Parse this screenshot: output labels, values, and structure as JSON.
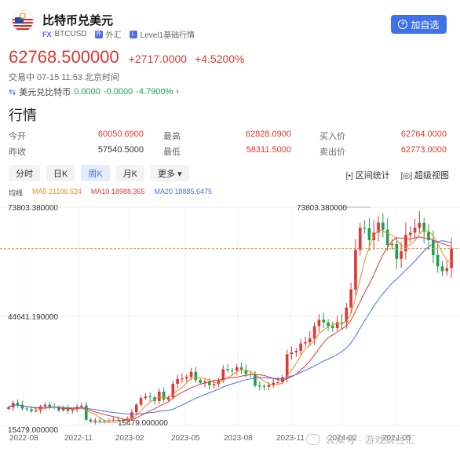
{
  "header": {
    "title": "比特币兑美元",
    "tag_fx": "FX",
    "symbol": "BTCUSD",
    "market": "外汇",
    "level": "Level1基础行情",
    "add_button": "加自选"
  },
  "price": {
    "last": "62768.500000",
    "change": "+2717.0000",
    "change_pct": "+4.5200%",
    "status": "交易中 07-15 11:53 北京时间"
  },
  "reverse": {
    "label": "美元兑比特币",
    "price": "0.0000",
    "change": "-0.0000",
    "pct": "-4.7900%"
  },
  "section_title": "行情",
  "quote": {
    "open_label": "今开",
    "open": "60050.6900",
    "high_label": "最高",
    "high": "62828.0900",
    "bid_label": "买入价",
    "bid": "62764.0000",
    "prev_label": "昨收",
    "prev": "57540.5000",
    "low_label": "最低",
    "low": "58311.5000",
    "ask_label": "卖出价",
    "ask": "62773.0000"
  },
  "tabs": [
    {
      "label": "分时",
      "active": false
    },
    {
      "label": "日K",
      "active": false
    },
    {
      "label": "周K",
      "active": true
    },
    {
      "label": "月K",
      "active": false
    },
    {
      "label": "更多 ▾",
      "active": false
    }
  ],
  "tools": {
    "range_stats": "区间统计",
    "super_view": "超级视图"
  },
  "ma": {
    "label": "均线",
    "ma5": "MA5 21106.524",
    "ma10": "MA10 18988.365",
    "ma20": "MA20 18885.6475"
  },
  "colors": {
    "up": "#e23636",
    "down": "#1aa34a",
    "ma5": "#f08a24",
    "ma10": "#e23636",
    "ma20": "#4a70e8",
    "accent": "#3f72e6"
  },
  "chart_data": {
    "type": "candlestick",
    "y_labels": [
      "73803.380000",
      "44641.190000",
      "15479.000000"
    ],
    "ylim": [
      15479.0,
      73803.38
    ],
    "max_label": "73803.380000",
    "min_label": "15479.000000",
    "x_ticks": [
      "2022-08",
      "2022-11",
      "2023-02",
      "2023-05",
      "2023-08",
      "2023-11",
      "2024-02",
      "2024-05"
    ],
    "last_price": 62768.5,
    "close": [
      20300,
      21500,
      21000,
      20000,
      19800,
      19300,
      19500,
      20600,
      21000,
      20500,
      20300,
      19500,
      20100,
      19400,
      19700,
      20500,
      20800,
      17000,
      16500,
      16800,
      16700,
      16600,
      16800,
      17000,
      16800,
      16900,
      17300,
      19000,
      21000,
      22800,
      23200,
      23000,
      22000,
      24500,
      22400,
      23000,
      26600,
      27900,
      28000,
      28400,
      29800,
      27600,
      26900,
      27200,
      26200,
      26500,
      27500,
      30500,
      30200,
      30100,
      31000,
      30300,
      29200,
      29000,
      26100,
      26000,
      25800,
      26300,
      26900,
      27000,
      28300,
      34500,
      35000,
      35400,
      37400,
      37700,
      38700,
      42000,
      43700,
      43000,
      42000,
      41500,
      43100,
      43000,
      47000,
      51800,
      62400,
      68300,
      68200,
      65000,
      67000,
      69700,
      67800,
      63700,
      64000,
      60000,
      62000,
      66400,
      67000,
      68300,
      69600,
      67200,
      65000,
      61000,
      58000,
      56700,
      57500,
      62768
    ]
  },
  "watermark": "公众号 · 游戏财经汇"
}
